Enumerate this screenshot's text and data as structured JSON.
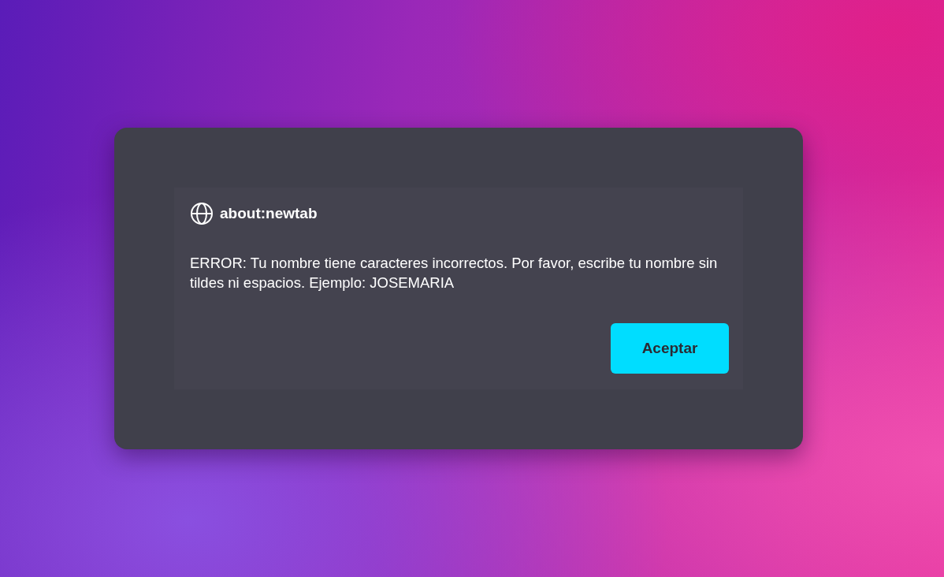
{
  "dialog": {
    "origin": "about:newtab",
    "message": "ERROR: Tu nombre tiene caracteres incorrectos. Por favor, escribe tu nombre sin tildes ni espacios. Ejemplo: JOSEMARIA",
    "buttons": [
      "Aceptar"
    ]
  }
}
